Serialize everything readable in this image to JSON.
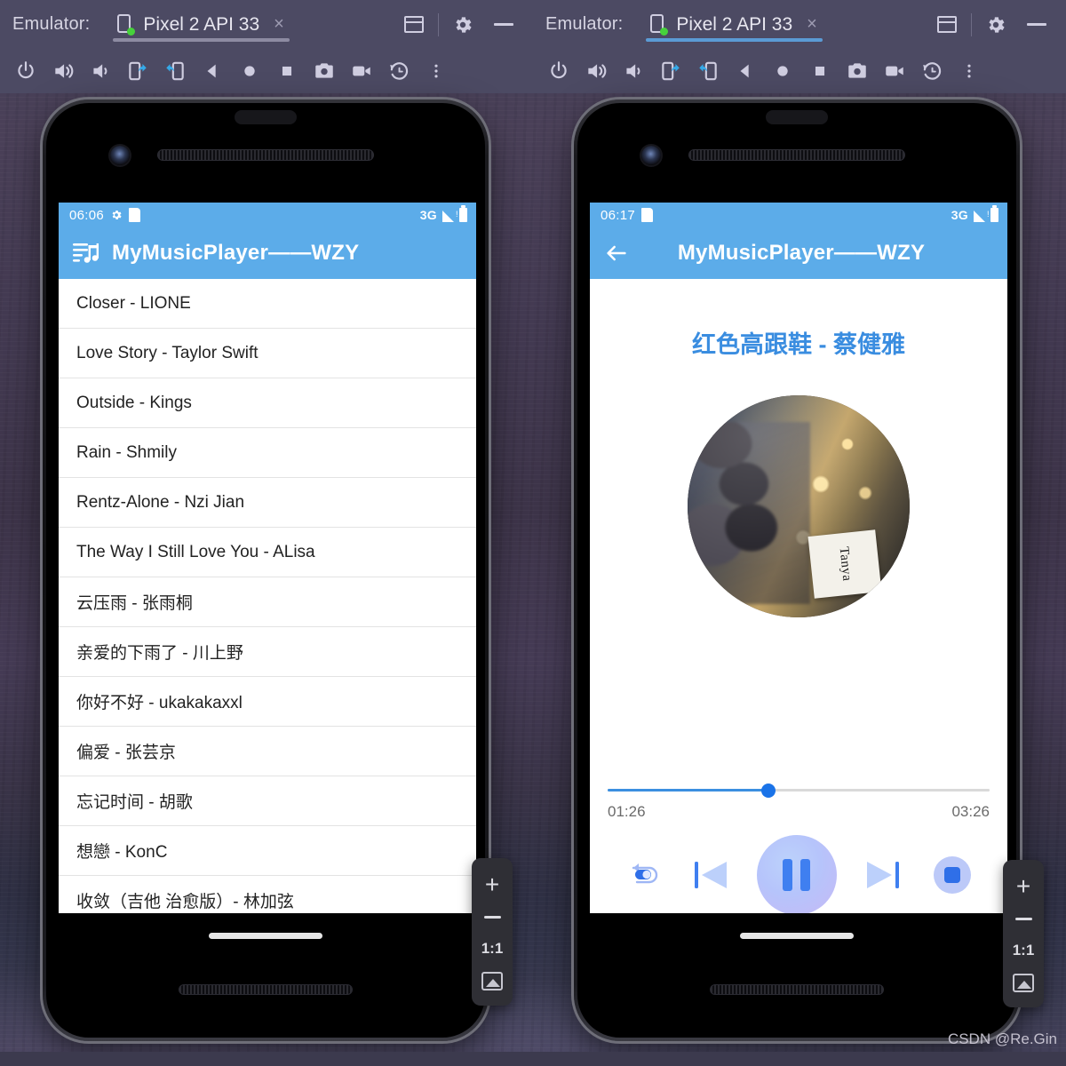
{
  "window": {
    "emulator_label": "Emulator:",
    "tab_title": "Pixel 2 API 33",
    "tab_close": "×",
    "controls": {
      "dock_icon": "dock-window-icon",
      "settings_icon": "gear-icon",
      "minimize_icon": "minimize-icon"
    },
    "toolbar_icons": [
      "power-icon",
      "volume-up-icon",
      "volume-down-icon",
      "rotate-left-icon",
      "rotate-right-icon",
      "back-nav-icon",
      "home-nav-icon",
      "overview-nav-icon",
      "screenshot-camera-icon",
      "record-video-icon",
      "history-restore-icon",
      "more-options-icon"
    ]
  },
  "zoom_rail": {
    "zoom_in": "+",
    "zoom_out": "–",
    "actual_size": "1:1",
    "image_icon": "image-icon"
  },
  "watermark": "CSDN @Re.Gin",
  "left_phone": {
    "status_bar": {
      "clock": "06:06",
      "icons_left": [
        "gear-icon",
        "sd-card-icon"
      ],
      "network": "3G",
      "icons_right": [
        "signal-icon",
        "battery-icon"
      ]
    },
    "app_bar": {
      "icon": "queue-music-icon",
      "title": "MyMusicPlayer——WZY"
    },
    "songs": [
      "Closer - LIONE",
      "Love Story - Taylor Swift",
      "Outside - Kings",
      "Rain - Shmily",
      "Rentz-Alone - Nzi  Jian",
      "The Way I Still Love You - ALisa",
      "云压雨 - 张雨桐",
      "亲爱的下雨了 - 川上野",
      "你好不好 - ukakakaxxl",
      "偏爱 - 张芸京",
      "忘记时间 - 胡歌",
      "想戀 - KonC",
      "收敛（吉他 治愈版）- 林加弦"
    ]
  },
  "right_phone": {
    "status_bar": {
      "clock": "06:17",
      "icons_left": [
        "sd-card-icon"
      ],
      "network": "3G",
      "icons_right": [
        "signal-icon",
        "battery-icon"
      ]
    },
    "app_bar": {
      "icon": "back-arrow-icon",
      "title": "MyMusicPlayer——WZY"
    },
    "now_playing": {
      "title": "红色高跟鞋 - 蔡健雅",
      "album_art_caption": "Tanya",
      "current_time": "01:26",
      "total_time": "03:26",
      "progress_percent": 42
    },
    "controls": [
      {
        "name": "repeat-button",
        "icon": "repeat-icon"
      },
      {
        "name": "previous-button",
        "icon": "skip-previous-icon"
      },
      {
        "name": "play-pause-button",
        "icon": "pause-icon"
      },
      {
        "name": "next-button",
        "icon": "skip-next-icon"
      },
      {
        "name": "stop-button",
        "icon": "stop-icon"
      }
    ]
  },
  "colors": {
    "app_bar_blue": "#5cace9",
    "accent_blue": "#3a8de0",
    "seek_fill": "#3b8fe0",
    "titlebar": "#4c4a63",
    "tab_active_underline": "#5b9bd5",
    "tab_inactive_underline": "#8d8ba2"
  }
}
